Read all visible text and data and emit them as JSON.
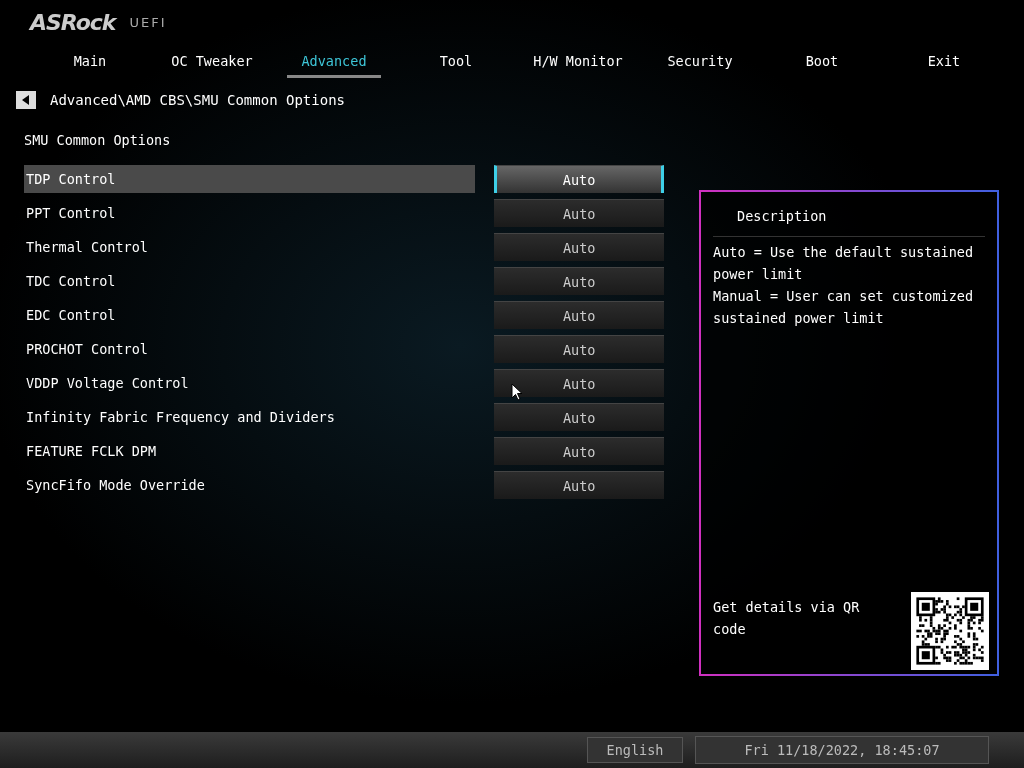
{
  "logo": {
    "brand": "ASRock",
    "suffix": "UEFI"
  },
  "tabs": [
    {
      "label": "Main",
      "selected": false
    },
    {
      "label": "OC Tweaker",
      "selected": false
    },
    {
      "label": "Advanced",
      "selected": true
    },
    {
      "label": "Tool",
      "selected": false
    },
    {
      "label": "H/W Monitor",
      "selected": false
    },
    {
      "label": "Security",
      "selected": false
    },
    {
      "label": "Boot",
      "selected": false
    },
    {
      "label": "Exit",
      "selected": false
    }
  ],
  "breadcrumb": "Advanced\\AMD CBS\\SMU Common Options",
  "page_title": "SMU Common Options",
  "options": [
    {
      "label": "TDP Control",
      "value": "Auto",
      "selected": true
    },
    {
      "label": "PPT Control",
      "value": "Auto",
      "selected": false
    },
    {
      "label": "Thermal Control",
      "value": "Auto",
      "selected": false
    },
    {
      "label": "TDC Control",
      "value": "Auto",
      "selected": false
    },
    {
      "label": "EDC Control",
      "value": "Auto",
      "selected": false
    },
    {
      "label": "PROCHOT Control",
      "value": "Auto",
      "selected": false
    },
    {
      "label": "VDDP Voltage Control",
      "value": "Auto",
      "selected": false
    },
    {
      "label": "Infinity Fabric Frequency and Dividers",
      "value": "Auto",
      "selected": false
    },
    {
      "label": "FEATURE FCLK DPM",
      "value": "Auto",
      "selected": false
    },
    {
      "label": "SyncFifo Mode Override",
      "value": "Auto",
      "selected": false
    }
  ],
  "description": {
    "title": "Description",
    "lines": [
      "Auto = Use the default sustained power limit",
      "Manual = User can set customized sustained power limit"
    ],
    "qr_text": "Get details via QR code"
  },
  "status_bar": {
    "language": "English",
    "datetime": "Fri 11/18/2022, 18:45:07"
  }
}
